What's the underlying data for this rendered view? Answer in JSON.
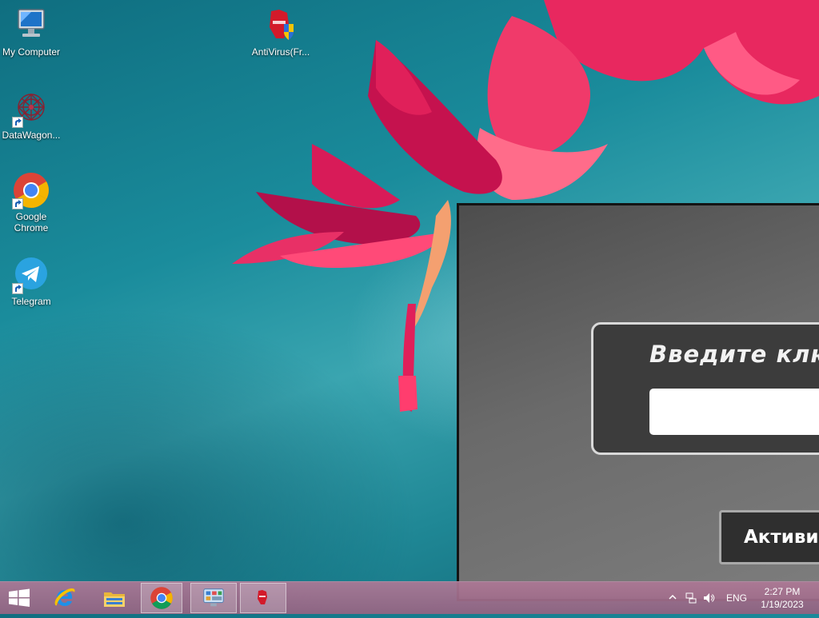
{
  "desktop": {
    "icons": [
      {
        "label": "My Computer",
        "icon": "computer-icon"
      },
      {
        "label": "DataWagon...",
        "icon": "datawagon-icon",
        "shortcut": true
      },
      {
        "label": "Google Chrome",
        "icon": "chrome-icon",
        "shortcut": true
      },
      {
        "label": "Telegram",
        "icon": "telegram-icon",
        "shortcut": true
      },
      {
        "label": "AntiVirus(Fr...",
        "icon": "antivirus-icon"
      }
    ]
  },
  "ransom_window": {
    "title": "Введите ключ",
    "key_value": "",
    "activate_label": "Активир"
  },
  "taskbar": {
    "apps": [
      {
        "name": "internet-explorer",
        "icon": "ie-icon",
        "active": false
      },
      {
        "name": "file-explorer",
        "icon": "folder-icon",
        "active": false
      },
      {
        "name": "chrome",
        "icon": "chrome-icon",
        "active": true
      },
      {
        "name": "control-panel",
        "icon": "control-panel-icon",
        "active": true
      },
      {
        "name": "antivirus",
        "icon": "antivirus-icon",
        "active": true
      }
    ],
    "tray": {
      "language": "ENG",
      "time": "2:27 PM",
      "date": "1/19/2023"
    }
  },
  "colors": {
    "wallpaper": "#1a8c9c",
    "flower": "#e0205a",
    "taskbar": "#a97596",
    "window": "#5a5a5a"
  }
}
